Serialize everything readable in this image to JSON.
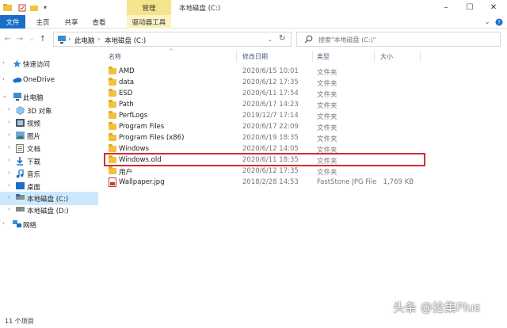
{
  "titlebar": {
    "manage_tab": "管理",
    "window_title": "本地磁盘 (C:)"
  },
  "ribbon": {
    "tabs": [
      "文件",
      "主页",
      "共享",
      "查看",
      "驱动器工具"
    ]
  },
  "address": {
    "segments": [
      "此电脑",
      "本地磁盘 (C:)"
    ],
    "search_placeholder": "搜索\"本地磁盘 (C:)\""
  },
  "sidebar": {
    "items": [
      {
        "label": "快速访问",
        "icon": "star-icon"
      },
      {
        "label": "OneDrive",
        "icon": "cloud-icon"
      },
      {
        "label": "此电脑",
        "icon": "computer-icon"
      },
      {
        "label": "3D 对象",
        "icon": "cube-icon"
      },
      {
        "label": "视频",
        "icon": "video-icon"
      },
      {
        "label": "图片",
        "icon": "picture-icon"
      },
      {
        "label": "文档",
        "icon": "document-icon"
      },
      {
        "label": "下载",
        "icon": "download-icon"
      },
      {
        "label": "音乐",
        "icon": "music-icon"
      },
      {
        "label": "桌面",
        "icon": "desktop-icon"
      },
      {
        "label": "本地磁盘 (C:)",
        "icon": "drive-icon"
      },
      {
        "label": "本地磁盘 (D:)",
        "icon": "drive-icon"
      },
      {
        "label": "网络",
        "icon": "network-icon"
      }
    ]
  },
  "columns": {
    "name": "名称",
    "date": "修改日期",
    "type": "类型",
    "size": "大小"
  },
  "files": [
    {
      "name": "AMD",
      "date": "2020/6/15 10:01",
      "type": "文件夹",
      "size": ""
    },
    {
      "name": "data",
      "date": "2020/6/12 17:35",
      "type": "文件夹",
      "size": ""
    },
    {
      "name": "ESD",
      "date": "2020/6/11 17:54",
      "type": "文件夹",
      "size": ""
    },
    {
      "name": "Path",
      "date": "2020/6/17 14:23",
      "type": "文件夹",
      "size": ""
    },
    {
      "name": "PerfLogs",
      "date": "2019/12/7 17:14",
      "type": "文件夹",
      "size": ""
    },
    {
      "name": "Program Files",
      "date": "2020/6/17 22:09",
      "type": "文件夹",
      "size": ""
    },
    {
      "name": "Program Files (x86)",
      "date": "2020/6/19 18:35",
      "type": "文件夹",
      "size": ""
    },
    {
      "name": "Windows",
      "date": "2020/6/12 14:05",
      "type": "文件夹",
      "size": ""
    },
    {
      "name": "Windows.old",
      "date": "2020/6/11 18:35",
      "type": "文件夹",
      "size": ""
    },
    {
      "name": "用户",
      "date": "2020/6/12 17:35",
      "type": "文件夹",
      "size": ""
    },
    {
      "name": "Wallpaper.jpg",
      "date": "2018/2/28 14:53",
      "type": "FastStone JPG File",
      "size": "1,769 KB"
    }
  ],
  "status": {
    "item_count": "11 个项目"
  },
  "watermark": "头条 @拾集Plus",
  "colors": {
    "file_tab": "#1a6ec7",
    "manage_tab": "#f4e58d",
    "selected": "#cce8ff",
    "highlight": "#d62b35"
  }
}
